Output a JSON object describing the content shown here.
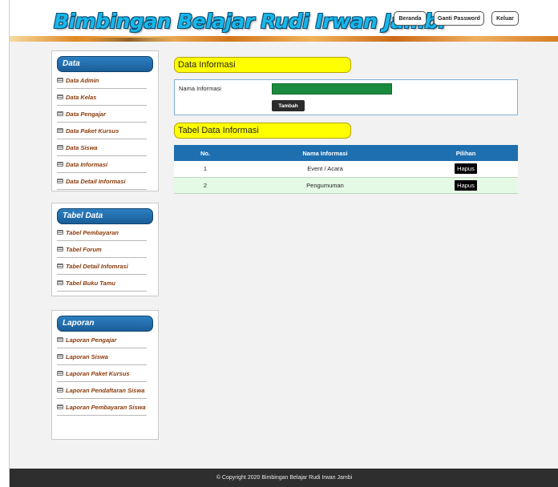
{
  "header": {
    "title": "Bimbingan Belajar Rudi Irwan Jambi",
    "buttons": {
      "beranda": "Beranda",
      "ganti_password": "Ganti Password",
      "keluar": "Keluar"
    }
  },
  "sidebar": {
    "data": {
      "title": "Data",
      "items": [
        "Data Admin",
        "Data Kelas",
        "Data Pengajar",
        "Data Paket Kursus",
        "Data Siswa",
        "Data Informasi",
        "Data Detail Informasi"
      ]
    },
    "tabel": {
      "title": "Tabel Data",
      "items": [
        "Tabel Pembayaran",
        "Tabel Forum",
        "Tabel Detail Infomrasi",
        "Tabel Buku Tamu"
      ]
    },
    "laporan": {
      "title": "Laporan",
      "items": [
        "Laporan Pengajar",
        "Laporan Siswa",
        "Laporan Paket Kursus",
        "Laporan Pendaftaran Siswa",
        "Laporan Pembayaran Siswa"
      ]
    }
  },
  "main": {
    "section_title": "Data Informasi",
    "form": {
      "label": "Nama Informasi",
      "input_value": "",
      "submit_label": "Tambah"
    },
    "table_title": "Tabel Data Informasi",
    "table": {
      "headers": [
        "No.",
        "Nama Informasi",
        "Pilihan"
      ],
      "rows": [
        {
          "no": "1",
          "nama": "Event / Acara",
          "action": "Hapus"
        },
        {
          "no": "2",
          "nama": "Pengumuman",
          "action": "Hapus"
        }
      ]
    }
  },
  "footer": {
    "text": "© Copyright 2020 Bimbingan Belajar Rudi Irwan Jambi"
  },
  "colors": {
    "title": "#19b6e8",
    "side_head": "#1a5e98",
    "pill": "#ffff00",
    "table_head": "#1e6fb0",
    "input": "#1a8a3e"
  }
}
